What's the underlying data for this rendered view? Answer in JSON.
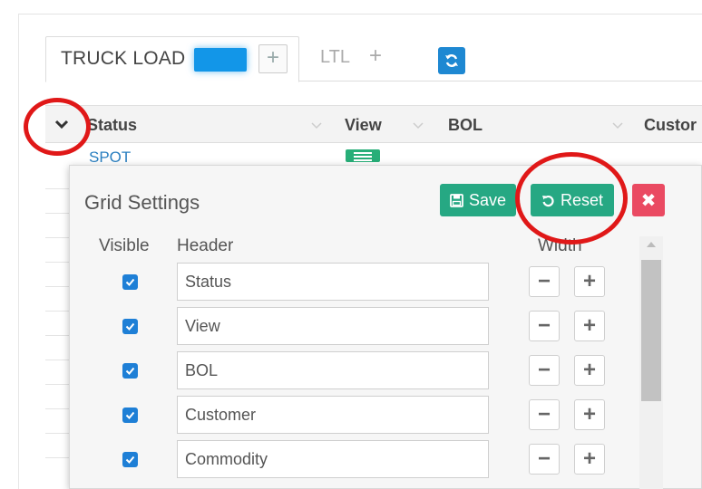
{
  "tabs": {
    "truck_load_label": "TRUCK LOAD",
    "plus_label": "+",
    "ltl_label": "LTL",
    "ltl_plus_label": "+"
  },
  "grid": {
    "columns": [
      {
        "label": "Status"
      },
      {
        "label": "View"
      },
      {
        "label": "BOL"
      },
      {
        "label": "Custor"
      }
    ],
    "first_row_status": "SPOT"
  },
  "panel": {
    "title": "Grid Settings",
    "save_label": "Save",
    "reset_label": "Reset",
    "close_label": "✖",
    "col_visible": "Visible",
    "col_header": "Header",
    "col_width": "Width",
    "rows": [
      {
        "header": "Status",
        "visible": true
      },
      {
        "header": "View",
        "visible": true
      },
      {
        "header": "BOL",
        "visible": true
      },
      {
        "header": "Customer",
        "visible": true
      },
      {
        "header": "Commodity",
        "visible": true
      }
    ],
    "minus_label": "−",
    "plus_label": "+"
  },
  "colors": {
    "tab_badge": "#1296e8",
    "refresh": "#1e88d2",
    "save_reset": "#26a883",
    "close": "#ea4a62",
    "annotation": "#e01818",
    "checkbox": "#1e7fd6"
  }
}
